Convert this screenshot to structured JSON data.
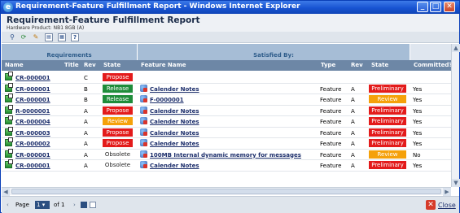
{
  "window": {
    "title": "Requirement-Feature Fulfillment Report - Windows Internet Explorer",
    "min_glyph": "_",
    "max_glyph": "□",
    "close_glyph": "✕"
  },
  "report": {
    "title": "Requirement-Feature Fulfillment Report",
    "subtitle": "Hardware Product: NB1 8GB (A)"
  },
  "toolbar": {
    "icons": [
      "funnel-icon",
      "refresh-icon",
      "export-icon",
      "columns-icon",
      "grid-icon",
      "help-icon"
    ],
    "glyphs": [
      "⚲",
      "⟳",
      "✎",
      "▤",
      "▦",
      "?"
    ]
  },
  "groups": {
    "requirements": "Requirements",
    "satisfied_by": "Satisfied By:"
  },
  "columns": {
    "name": "Name",
    "title": "Title",
    "rev": "Rev",
    "state": "State",
    "feature_name": "Feature Name",
    "type": "Type",
    "frev": "Rev",
    "fstate": "State",
    "committed": "Committed?"
  },
  "rows": [
    {
      "name": "CR-000001",
      "rev": "C",
      "state": "Propose",
      "feature": "",
      "type": "",
      "frev": "",
      "fstate": "",
      "committed": ""
    },
    {
      "name": "CR-000001",
      "rev": "B",
      "state": "Release",
      "feature": "Calender Notes",
      "type": "Feature",
      "frev": "A",
      "fstate": "Preliminary",
      "committed": "Yes"
    },
    {
      "name": "CR-000001",
      "rev": "B",
      "state": "Release",
      "feature": "F-0000001",
      "type": "Feature",
      "frev": "A",
      "fstate": "Review",
      "committed": "Yes"
    },
    {
      "name": "R-0000001",
      "rev": "A",
      "state": "Propose",
      "feature": "Calender Notes",
      "type": "Feature",
      "frev": "A",
      "fstate": "Preliminary",
      "committed": "Yes"
    },
    {
      "name": "CR-000004",
      "rev": "A",
      "state": "Review",
      "feature": "Calender Notes",
      "type": "Feature",
      "frev": "A",
      "fstate": "Preliminary",
      "committed": "Yes"
    },
    {
      "name": "CR-000003",
      "rev": "A",
      "state": "Propose",
      "feature": "Calender Notes",
      "type": "Feature",
      "frev": "A",
      "fstate": "Preliminary",
      "committed": "Yes"
    },
    {
      "name": "CR-000002",
      "rev": "A",
      "state": "Propose",
      "feature": "Calender Notes",
      "type": "Feature",
      "frev": "A",
      "fstate": "Preliminary",
      "committed": "Yes"
    },
    {
      "name": "CR-000001",
      "rev": "A",
      "state": "Obsolete",
      "feature": "100MB Internal dynamic memory for messages",
      "type": "Feature",
      "frev": "A",
      "fstate": "Review",
      "committed": "No"
    },
    {
      "name": "CR-000001",
      "rev": "A",
      "state": "Obsolete",
      "feature": "Calender Notes",
      "type": "Feature",
      "frev": "A",
      "fstate": "Preliminary",
      "committed": "Yes"
    }
  ],
  "status_colors": {
    "Propose": "#e31b1b",
    "Release": "#1e8c3a",
    "Review": "#f5a10a",
    "Preliminary": "#e31b1b"
  },
  "pager": {
    "first_glyph": "‹",
    "page_label": "Page",
    "page_value": "1",
    "of_label": "of 1",
    "next_glyph": "›"
  },
  "footer": {
    "close_label": "Close"
  }
}
